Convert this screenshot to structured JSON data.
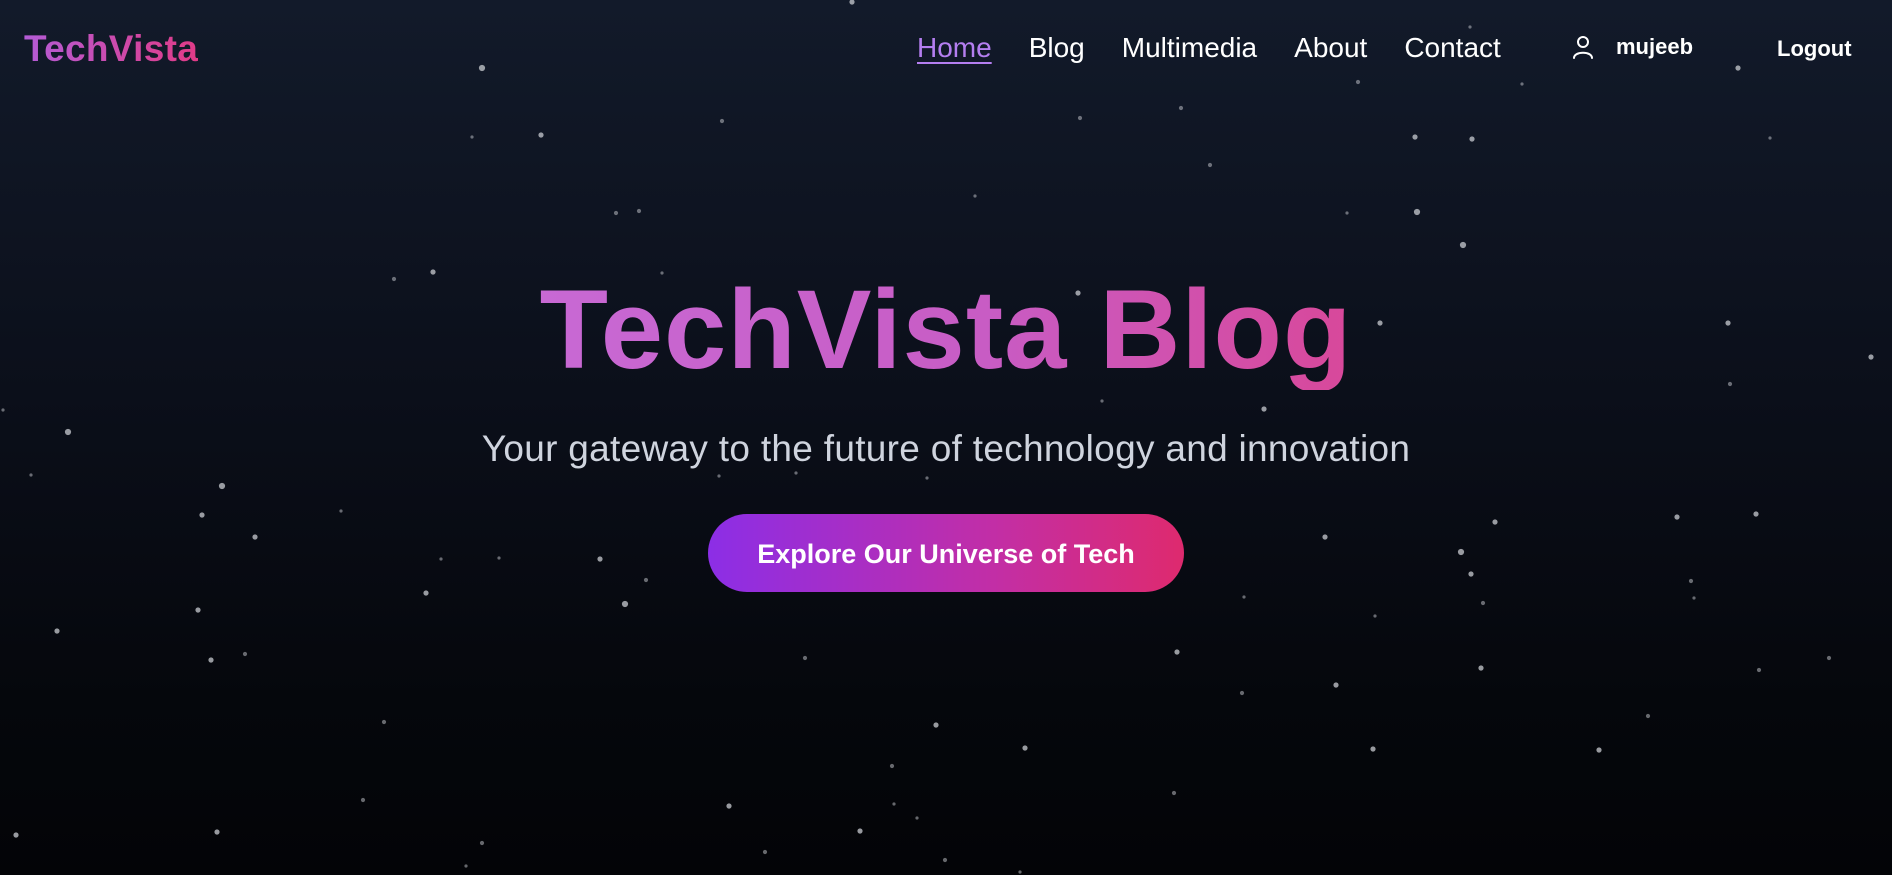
{
  "navbar": {
    "logo": "TechVista",
    "links": [
      {
        "label": "Home",
        "active": true
      },
      {
        "label": "Blog",
        "active": false
      },
      {
        "label": "Multimedia",
        "active": false
      },
      {
        "label": "About",
        "active": false
      },
      {
        "label": "Contact",
        "active": false
      }
    ],
    "user_icon": "user-icon",
    "username": "mujeeb",
    "logout_label": "Logout"
  },
  "hero": {
    "title": "TechVista Blog",
    "subtitle": "Your gateway to the future of technology and innovation",
    "cta_label": "Explore Our Universe of Tech"
  },
  "colors": {
    "accent_purple": "#8c2ee6",
    "accent_pink": "#de2a6e",
    "active_link": "#b47ef0",
    "background_top": "#121a2a",
    "background_bottom": "#030407"
  }
}
